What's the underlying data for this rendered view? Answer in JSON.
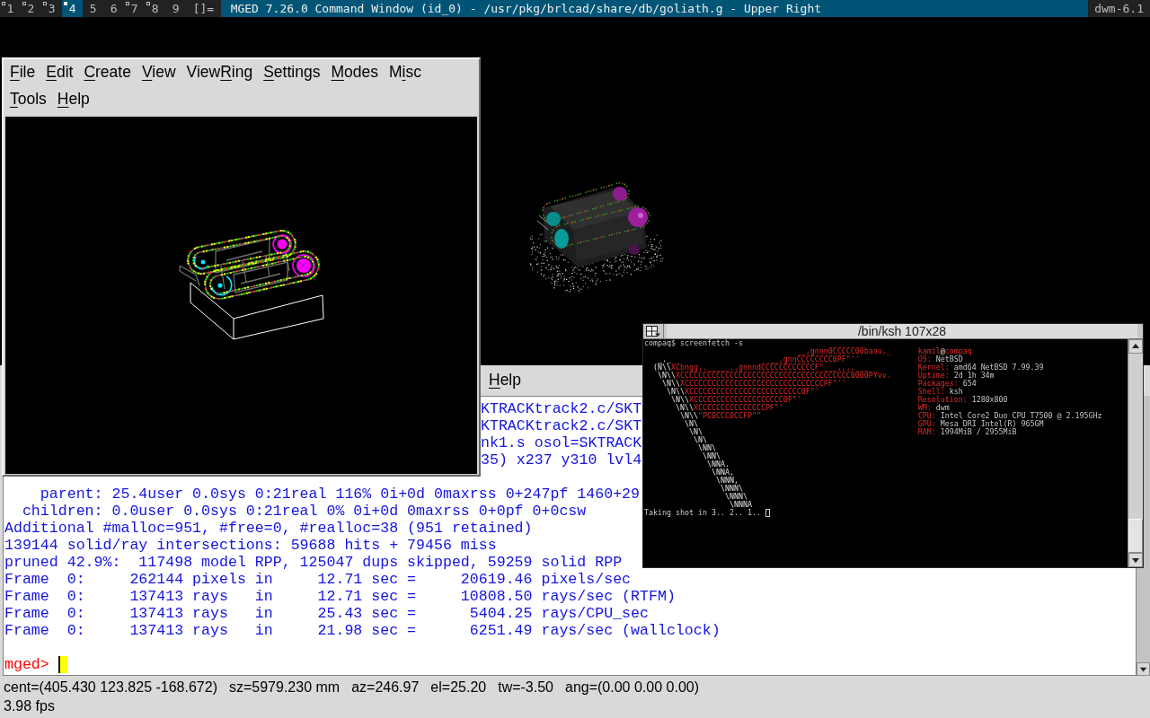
{
  "bar": {
    "tags": [
      {
        "label": "1",
        "selected": false,
        "occupied": true
      },
      {
        "label": "2",
        "selected": false,
        "occupied": true
      },
      {
        "label": "3",
        "selected": false,
        "occupied": true
      },
      {
        "label": "4",
        "selected": true,
        "occupied": true
      },
      {
        "label": "5",
        "selected": false,
        "occupied": false
      },
      {
        "label": "6",
        "selected": false,
        "occupied": false
      },
      {
        "label": "7",
        "selected": false,
        "occupied": true
      },
      {
        "label": "8",
        "selected": false,
        "occupied": true
      },
      {
        "label": "9",
        "selected": false,
        "occupied": false
      }
    ],
    "layout": "[]=",
    "title": "MGED 7.26.0 Command Window (id_0) - /usr/pkg/brlcad/share/db/goliath.g - Upper Right",
    "status": "dwm-6.1"
  },
  "graphics_window": {
    "menu_rows": [
      [
        {
          "key": "F",
          "after": "ile"
        },
        {
          "key": "E",
          "after": "dit"
        },
        {
          "key": "C",
          "after": "reate"
        },
        {
          "key": "V",
          "after": "iew"
        },
        {
          "before": "View",
          "key": "R",
          "after": "ing"
        },
        {
          "key": "S",
          "after": "ettings"
        },
        {
          "key": "M",
          "after": "odes"
        },
        {
          "before": "M",
          "key": "i",
          "after": "sc"
        }
      ],
      [
        {
          "key": "T",
          "after": "ools"
        },
        {
          "key": "H",
          "after": "elp"
        }
      ]
    ]
  },
  "command_window": {
    "menu": [
      {
        "key": "H",
        "after": "elp"
      }
    ],
    "output_covered": [
      "KTRACKtrack2.c/SKT",
      "KTRACKtrack2.c/SKT",
      "nk1.s osol=SKTRACK",
      "35) x237 y310 lvl4"
    ],
    "output": [
      "    parent: 25.4user 0.0sys 0:21real 116% 0i+0d 0maxrss 0+247pf 1460+29",
      "  children: 0.0user 0.0sys 0:21real 0% 0i+0d 0maxrss 0+0pf 0+0csw",
      "Additional #malloc=951, #free=0, #realloc=38 (951 retained)",
      "139144 solid/ray intersections: 59688 hits + 79456 miss",
      "pruned 42.9%:  117498 model RPP, 125047 dups skipped, 59259 solid RPP",
      "Frame  0:     262144 pixels in     12.71 sec =     20619.46 pixels/sec",
      "Frame  0:     137413 rays   in     12.71 sec =     10808.50 rays/sec (RTFM)",
      "Frame  0:     137413 rays   in     25.43 sec =      5404.25 rays/CPU_sec",
      "Frame  0:     137413 rays   in     21.98 sec =      6251.49 rays/sec (wallclock)"
    ],
    "prompt": "mged>"
  },
  "status": {
    "fields": [
      "cent=(405.430 123.825 -168.672)",
      "sz=5979.230 mm",
      "az=246.97",
      "el=25.20",
      "tw=-3.50",
      "ang=(0.00 0.00 0.00)"
    ],
    "fps": "3.98 fps"
  },
  "terminal": {
    "title": "/bin/ksh 107x28",
    "command": "compaq$ screenfetch -s",
    "logo": [
      {
        "fill": "                                  __,gnnn0CCCCC00baau,_"
      },
      {
        "outline": "   _._",
        "fill": "                      __,gnnCCCCCCCC0PF\"''"
      },
      {
        "outline": "  (N\\\\",
        "fill": "XCbngg,._____.,gnnndCCCCCCCCCCCCF\"___,,,,___"
      },
      {
        "outline": "   \\N\\\\",
        "fill": "XCCCCCCCCCCCCCCCCCCCCCCCCCCCCCCCCCCCCCC0000PYvv."
      },
      {
        "outline": "    \\N\\\\",
        "fill": "XCCCCCCCCCCCCCCCCCCCCCCCCCCCCCCCPF\"''"
      },
      {
        "outline": "     \\N\\\\",
        "fill": "XCCCCCCCCCCCCCCCCCCCCCCCCC0F\"'"
      },
      {
        "outline": "      \\N\\\\",
        "fill": "XCCCCCCCCCCCCCCCCCCCC0F\"'"
      },
      {
        "outline": "       \\N\\\\",
        "fill": "XCCCCCCCCCCCCCCCPF\"'"
      },
      {
        "outline": "        \\N\\\\",
        "fill": "\"PC0CCC0CCFP\"\""
      },
      {
        "outline": "         \\N\\"
      },
      {
        "outline": "          \\N\\"
      },
      {
        "outline": "           \\N\\"
      },
      {
        "outline": "            \\NN\\"
      },
      {
        "outline": "             \\NN\\"
      },
      {
        "outline": "              \\NNA."
      },
      {
        "outline": "               \\NNA,"
      },
      {
        "outline": "                \\NNN,"
      },
      {
        "outline": "                 \\NNN\\"
      },
      {
        "outline": "                  \\NNN\\"
      },
      {
        "outline": "                   \\NNNA"
      }
    ],
    "user": "kamil",
    "at": "@",
    "host": "compaq",
    "info": [
      {
        "label": "OS:",
        "value": "NetBSD"
      },
      {
        "label": "Kernel:",
        "value": "amd64 NetBSD 7.99.39"
      },
      {
        "label": "Uptime:",
        "value": "2d 1h 34m"
      },
      {
        "label": "Packages:",
        "value": "654"
      },
      {
        "label": "Shell:",
        "value": "ksh"
      },
      {
        "label": "Resolution:",
        "value": "1280x800"
      },
      {
        "label": "WM:",
        "value": "dwm"
      },
      {
        "label": "CPU:",
        "value": "Intel Core2 Duo CPU T7500 @ 2.195GHz"
      },
      {
        "label": "GPU:",
        "value": "Mesa DRI Intel(R) 965GM"
      },
      {
        "label": "RAM:",
        "value": "1994MiB / 2955MiB"
      }
    ],
    "message": "Taking shot in 3.. 2.. 1.."
  }
}
